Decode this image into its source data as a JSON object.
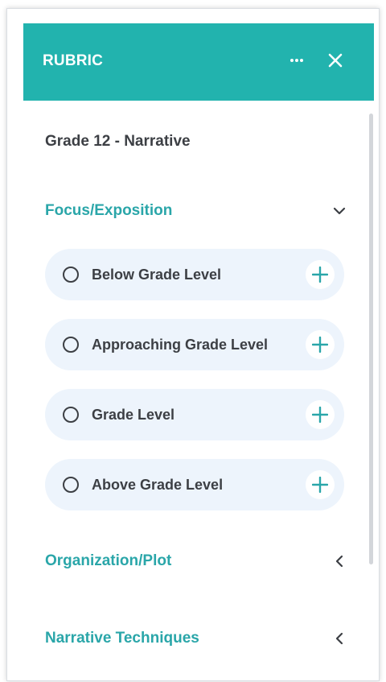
{
  "header": {
    "title": "RUBRIC",
    "more_icon": "ellipsis-icon",
    "close_icon": "close-icon",
    "color": "#22b3ae"
  },
  "rubric": {
    "title": "Grade 12 - Narrative"
  },
  "sections": [
    {
      "label": "Focus/Exposition",
      "state": "expanded",
      "options": [
        {
          "label": "Below Grade Level"
        },
        {
          "label": "Approaching Grade Level"
        },
        {
          "label": "Grade Level"
        },
        {
          "label": "Above Grade Level"
        }
      ]
    },
    {
      "label": "Organization/Plot",
      "state": "collapsed"
    },
    {
      "label": "Narrative Techniques",
      "state": "collapsed"
    }
  ],
  "colors": {
    "accent": "#2aa6a9",
    "option_bg": "#edf4fc",
    "text": "#3c3f44"
  }
}
